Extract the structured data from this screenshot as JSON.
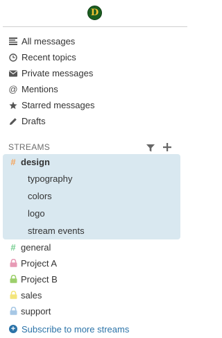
{
  "logo": {
    "letter": "D"
  },
  "global_filters": [
    {
      "label": "All messages",
      "icon": "list-icon"
    },
    {
      "label": "Recent topics",
      "icon": "clock-icon"
    },
    {
      "label": "Private messages",
      "icon": "envelope-icon"
    },
    {
      "label": "Mentions",
      "icon": "at-icon"
    },
    {
      "label": "Starred messages",
      "icon": "star-icon"
    },
    {
      "label": "Drafts",
      "icon": "pencil-icon"
    }
  ],
  "streams_header": {
    "label": "STREAMS"
  },
  "streams": [
    {
      "name": "design",
      "marker": "#",
      "color": "#f5a55b",
      "type": "public",
      "active": true,
      "topics": [
        "typography",
        "colors",
        "logo",
        "stream events"
      ]
    },
    {
      "name": "general",
      "marker": "#",
      "color": "#76ce90",
      "type": "public",
      "active": false
    },
    {
      "name": "Project A",
      "color": "#e79ab5",
      "type": "private",
      "active": false
    },
    {
      "name": "Project B",
      "color": "#a6c7e5",
      "type": "private",
      "active": false
    },
    {
      "name": "sales",
      "color": "#f3e57a",
      "type": "private",
      "active": false
    },
    {
      "name": "support",
      "color": "#a6c7e5",
      "type": "private",
      "active": false
    }
  ],
  "footer": {
    "subscribe_label": "Subscribe to more streams"
  },
  "colors": {
    "accent": "#2b73a8",
    "active_highlight": "#d9e8f0",
    "logo_bg": "#1b5e20",
    "logo_fg": "#f1c232"
  }
}
